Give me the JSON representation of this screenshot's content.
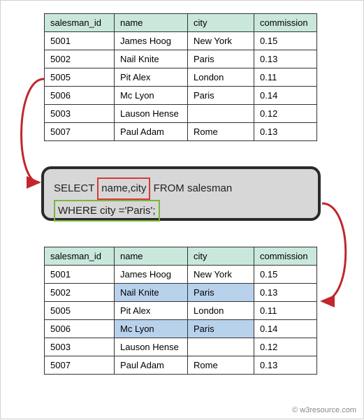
{
  "headers": {
    "salesman_id": "salesman_id",
    "name": "name",
    "city": "city",
    "commission": "commission"
  },
  "table1": {
    "rows": [
      {
        "id": "5001",
        "name": "James Hoog",
        "city": "New York",
        "comm": "0.15"
      },
      {
        "id": "5002",
        "name": "Nail Knite",
        "city": "Paris",
        "comm": "0.13"
      },
      {
        "id": "5005",
        "name": "Pit Alex",
        "city": "London",
        "comm": "0.11"
      },
      {
        "id": "5006",
        "name": "Mc Lyon",
        "city": "Paris",
        "comm": "0.14"
      },
      {
        "id": "5003",
        "name": "Lauson Hense",
        "city": "",
        "comm": "0.12"
      },
      {
        "id": "5007",
        "name": "Paul Adam",
        "city": "Rome",
        "comm": "0.13"
      }
    ]
  },
  "query": {
    "select": "SELECT",
    "cols": "name,city",
    "from": "FROM  salesman",
    "where_clause": "WHERE city ='Paris';"
  },
  "table2": {
    "rows": [
      {
        "id": "5001",
        "name": "James Hoog",
        "city": "New York",
        "comm": "0.15",
        "hl": false
      },
      {
        "id": "5002",
        "name": "Nail Knite",
        "city": "Paris",
        "comm": "0.13",
        "hl": true
      },
      {
        "id": "5005",
        "name": "Pit Alex",
        "city": "London",
        "comm": "0.11",
        "hl": false
      },
      {
        "id": "5006",
        "name": "Mc Lyon",
        "city": "Paris",
        "comm": "0.14",
        "hl": true
      },
      {
        "id": "5003",
        "name": "Lauson Hense",
        "city": "",
        "comm": "0.12",
        "hl": false
      },
      {
        "id": "5007",
        "name": "Paul Adam",
        "city": "Rome",
        "comm": "0.13",
        "hl": false
      }
    ]
  },
  "credit": "© w3resource.com",
  "chart_data": {
    "type": "table",
    "description": "SQL SELECT with WHERE clause diagram. Top table is the source salesman table; middle box is the query; bottom table is the source with name,city cells highlighted where city='Paris'. Arrows flow top→query→bottom.",
    "source_table": [
      {
        "salesman_id": 5001,
        "name": "James Hoog",
        "city": "New York",
        "commission": 0.15
      },
      {
        "salesman_id": 5002,
        "name": "Nail Knite",
        "city": "Paris",
        "commission": 0.13
      },
      {
        "salesman_id": 5005,
        "name": "Pit Alex",
        "city": "London",
        "commission": 0.11
      },
      {
        "salesman_id": 5006,
        "name": "Mc Lyon",
        "city": "Paris",
        "commission": 0.14
      },
      {
        "salesman_id": 5003,
        "name": "Lauson Hense",
        "city": null,
        "commission": 0.12
      },
      {
        "salesman_id": 5007,
        "name": "Paul Adam",
        "city": "Rome",
        "commission": 0.13
      }
    ],
    "sql": "SELECT name,city FROM salesman WHERE city ='Paris';",
    "highlighted_columns": [
      "name",
      "city"
    ],
    "filter": {
      "column": "city",
      "equals": "Paris"
    },
    "matching_salesman_ids": [
      5002,
      5006
    ]
  }
}
